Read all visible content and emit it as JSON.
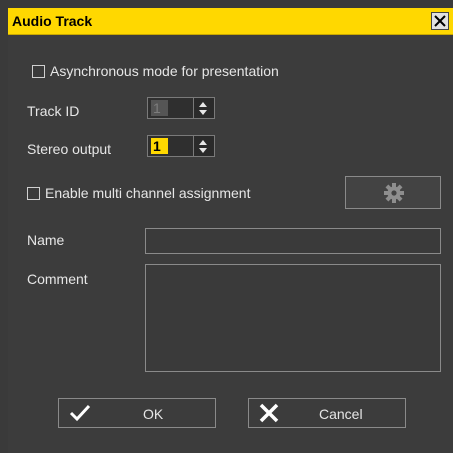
{
  "window": {
    "title": "Audio Track"
  },
  "options": {
    "async_label": "Asynchronous mode for presentation",
    "async_checked": false,
    "track_id_label": "Track ID",
    "track_id_value": "1",
    "stereo_label": "Stereo output",
    "stereo_value": "1",
    "multi_channel_label": "Enable multi channel assignment",
    "multi_channel_checked": false
  },
  "fields": {
    "name_label": "Name",
    "name_value": "",
    "comment_label": "Comment",
    "comment_value": ""
  },
  "buttons": {
    "ok_label": "OK",
    "cancel_label": "Cancel"
  },
  "icons": {
    "close": "close-icon",
    "gear": "gear-icon",
    "ok": "checkmark-icon",
    "cancel": "cross-icon",
    "spin_up": "arrow-up-icon",
    "spin_down": "arrow-down-icon"
  },
  "colors": {
    "title_bar": "#ffd800",
    "window_bg": "#3c3c3c",
    "text": "#e6e6e6",
    "highlight": "#ffd800"
  }
}
